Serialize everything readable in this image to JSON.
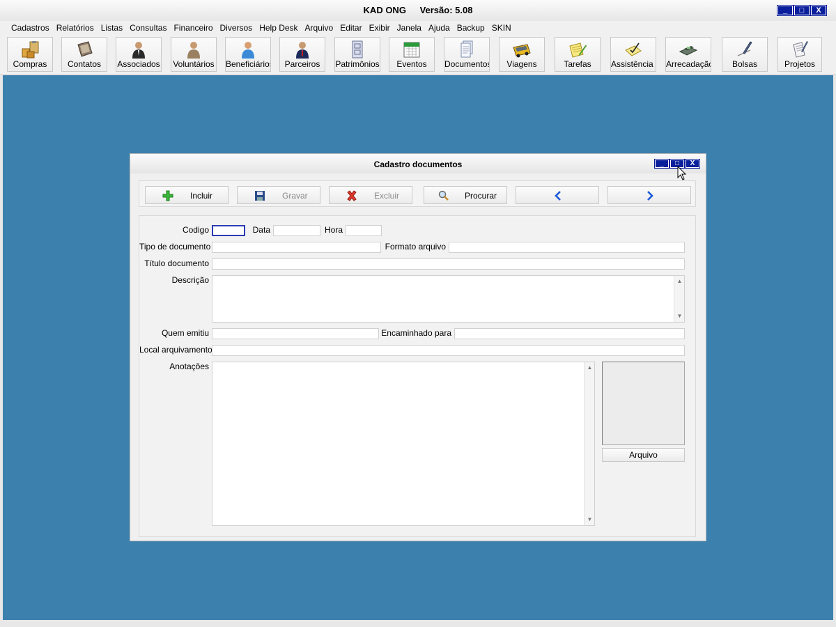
{
  "app": {
    "name": "KAD ONG",
    "version": "Versão: 5.08",
    "window_controls": {
      "minimize": "_",
      "maximize": "□",
      "close": "X"
    }
  },
  "menu": [
    "Cadastros",
    "Relatórios",
    "Listas",
    "Consultas",
    "Financeiro",
    "Diversos",
    "Help Desk",
    "Arquivo",
    "Editar",
    "Exibir",
    "Janela",
    "Ajuda",
    "Backup",
    "SKIN"
  ],
  "toolbar": {
    "buttons": [
      {
        "label": "Compras",
        "icon": "boxes-clipboard-icon"
      },
      {
        "label": "Contatos",
        "icon": "address-book-icon"
      },
      {
        "label": "Associados",
        "icon": "person-suit-icon"
      },
      {
        "label": "Voluntários",
        "icon": "person-volunteer-icon"
      },
      {
        "label": "Beneficiários",
        "icon": "person-blue-icon"
      },
      {
        "label": "Parceiros",
        "icon": "person-tie-icon"
      },
      {
        "label": "Patrimônios",
        "icon": "file-cabinet-icon"
      },
      {
        "label": "Eventos",
        "icon": "calendar-icon"
      },
      {
        "label": "Documentos",
        "icon": "documents-icon"
      },
      {
        "label": "Viagens",
        "icon": "bus-icon"
      },
      {
        "label": "Tarefas",
        "icon": "notepad-pencil-icon"
      },
      {
        "label": "Assistência S",
        "icon": "pad-check-icon"
      },
      {
        "label": "Arrecadação",
        "icon": "cash-register-icon"
      },
      {
        "label": "Bolsas",
        "icon": "pen-signature-icon"
      },
      {
        "label": "Projetos",
        "icon": "papers-pen-icon"
      }
    ]
  },
  "dialog": {
    "title": "Cadastro documentos",
    "toolbar": {
      "incluir": "Incluir",
      "gravar": "Gravar",
      "excluir": "Excluir",
      "procurar": "Procurar",
      "prev_icon": "arrow-left-icon",
      "next_icon": "arrow-right-icon"
    },
    "form": {
      "codigo": {
        "label": "Codigo",
        "value": ""
      },
      "data": {
        "label": "Data",
        "value": ""
      },
      "hora": {
        "label": "Hora",
        "value": ""
      },
      "tipo_documento": {
        "label": "Tipo de documento",
        "value": ""
      },
      "formato_arquivo": {
        "label": "Formato arquivo",
        "value": ""
      },
      "titulo_documento": {
        "label": "Título documento",
        "value": ""
      },
      "descricao": {
        "label": "Descrição",
        "value": ""
      },
      "quem_emitiu": {
        "label": "Quem emitiu",
        "value": ""
      },
      "encaminhado_para": {
        "label": "Encaminhado para",
        "value": ""
      },
      "local_arquivamento": {
        "label": "Local arquivamento",
        "value": ""
      },
      "anotacoes": {
        "label": "Anotações",
        "value": ""
      },
      "arquivo_button": "Arquivo"
    }
  },
  "colors": {
    "desktop": "#3c80ad",
    "window_button": "#0b1f9c",
    "focus_border": "#2b3bb5"
  }
}
